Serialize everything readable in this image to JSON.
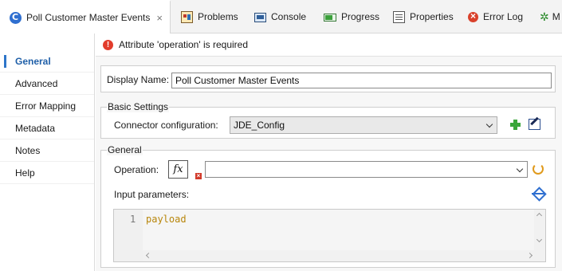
{
  "tabs": [
    {
      "label": "Poll Customer Master Events",
      "icon": "mule-icon",
      "active": true
    },
    {
      "label": "Problems",
      "icon": "problems-icon"
    },
    {
      "label": "Console",
      "icon": "console-icon"
    },
    {
      "label": "Progress",
      "icon": "progress-icon"
    },
    {
      "label": "Properties",
      "icon": "properties-icon"
    },
    {
      "label": "Error Log",
      "icon": "error-log-icon"
    },
    {
      "label": "M",
      "icon": "more-icon"
    }
  ],
  "close_glyph": "×",
  "sidebar": {
    "items": [
      {
        "label": "General",
        "selected": true
      },
      {
        "label": "Advanced"
      },
      {
        "label": "Error Mapping"
      },
      {
        "label": "Metadata"
      },
      {
        "label": "Notes"
      },
      {
        "label": "Help"
      }
    ]
  },
  "error_banner": {
    "icon": "!",
    "message": "Attribute 'operation' is required"
  },
  "display_name": {
    "label": "Display Name:",
    "value": "Poll Customer Master Events"
  },
  "basic_settings": {
    "title": "Basic Settings",
    "connector_label": "Connector configuration:",
    "connector_value": "JDE_Config"
  },
  "general": {
    "title": "General",
    "operation_label": "Operation:",
    "fx_label": "fx",
    "operation_value": "",
    "input_params_label": "Input parameters:",
    "editor": {
      "line_number": "1",
      "code": "payload"
    }
  },
  "colors": {
    "accent": "#2e75c9",
    "error": "#e23c2c",
    "add": "#3aa63a",
    "code": "#b8860b"
  }
}
